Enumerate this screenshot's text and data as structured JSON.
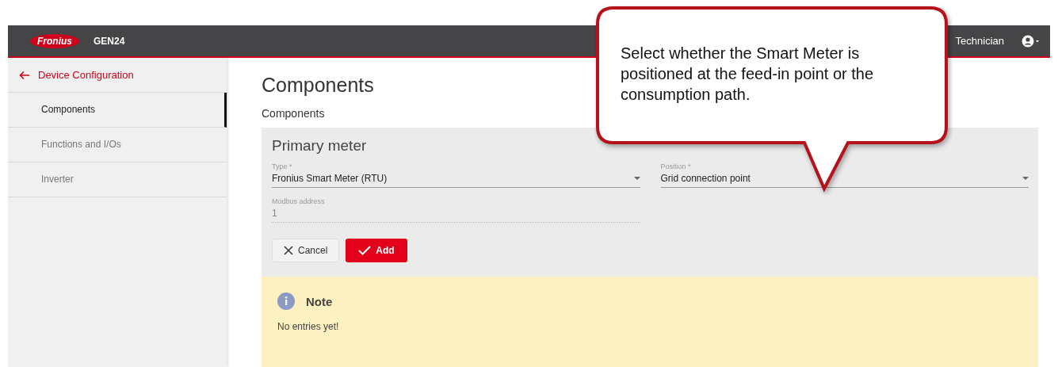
{
  "header": {
    "logo": "Fronius",
    "product": "GEN24",
    "user": "Technician"
  },
  "sidebar": {
    "back": "Device Configuration",
    "items": [
      {
        "label": "Components",
        "selected": true
      },
      {
        "label": "Functions and I/Os",
        "selected": false
      },
      {
        "label": "Inverter",
        "selected": false
      }
    ]
  },
  "page": {
    "title": "Components",
    "subtitle": "Components"
  },
  "card": {
    "title": "Primary meter",
    "fields": [
      {
        "kind": "select",
        "label": "Type *",
        "value": "Fronius Smart Meter (RTU)",
        "disabled": false
      },
      {
        "kind": "select",
        "label": "Position *",
        "value": "Grid connection point",
        "disabled": false
      },
      {
        "kind": "text",
        "label": "Modbus address",
        "value": "1",
        "disabled": true
      }
    ],
    "buttons": [
      {
        "kind": "cancel",
        "label": "Cancel"
      },
      {
        "kind": "add",
        "label": "Add"
      }
    ]
  },
  "note": {
    "title": "Note",
    "text": "No entries yet!"
  },
  "callout": {
    "text": "Select whether the Smart Meter is positioned at the feed-in point or the consumption path."
  }
}
